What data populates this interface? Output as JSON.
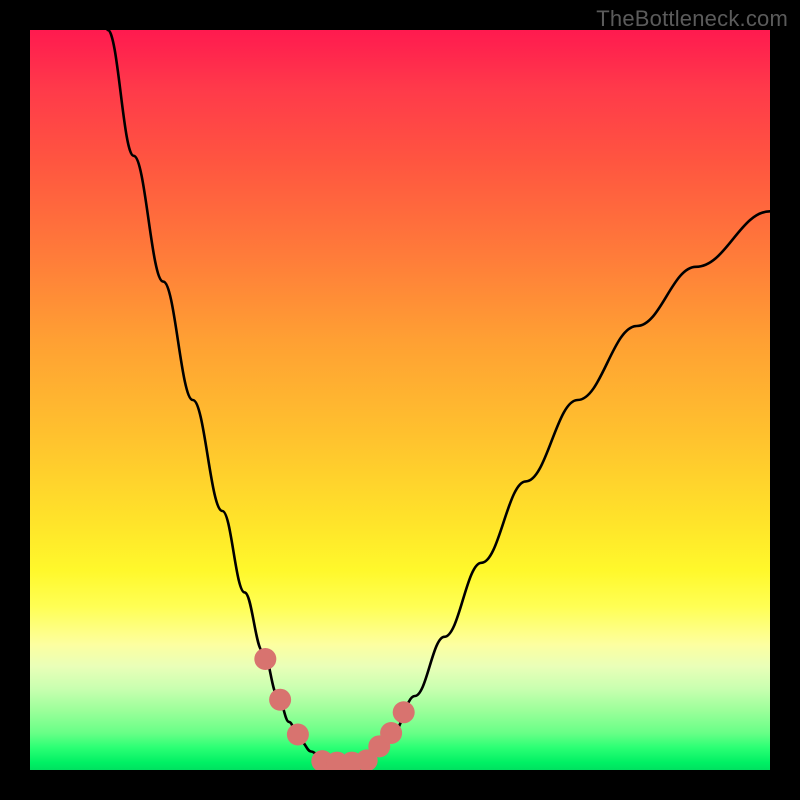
{
  "watermark": "TheBottleneck.com",
  "chart_data": {
    "type": "line",
    "title": "",
    "xlabel": "",
    "ylabel": "",
    "xlim": [
      0,
      100
    ],
    "ylim": [
      0,
      100
    ],
    "series": [
      {
        "name": "curve",
        "color": "#000000",
        "x": [
          10.5,
          14,
          18,
          22,
          26,
          29,
          31.5,
          33.5,
          35,
          36.5,
          38,
          39.5,
          41,
          43,
          45,
          47,
          49,
          52,
          56,
          61,
          67,
          74,
          82,
          90,
          100
        ],
        "values": [
          100,
          83,
          66,
          50,
          35,
          24,
          16,
          10,
          6.5,
          4,
          2.5,
          1.5,
          1,
          1,
          1,
          2.5,
          5,
          10,
          18,
          28,
          39,
          50,
          60,
          68,
          75.5
        ]
      }
    ],
    "markers": {
      "name": "highlighted-points",
      "color": "#d8736f",
      "radius_px": 11,
      "x": [
        31.8,
        33.8,
        36.2,
        39.5,
        41.5,
        43.5,
        45.5,
        47.2,
        48.8,
        50.5
      ],
      "values": [
        15,
        9.5,
        4.8,
        1.2,
        1.0,
        1.0,
        1.3,
        3.2,
        5.0,
        7.8
      ]
    }
  }
}
